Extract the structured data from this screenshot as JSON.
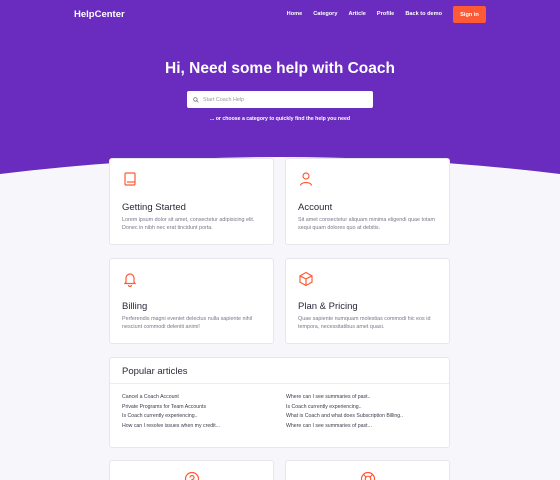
{
  "brand": {
    "name": "HelpCenter",
    "primary": "#6a2bbf",
    "accent": "#ff5a36"
  },
  "nav": {
    "items": [
      "Home",
      "Category",
      "Article",
      "Profile",
      "Back to demo"
    ],
    "signin": "Sign in"
  },
  "hero": {
    "title": "Hi, Need some help with Coach",
    "search_placeholder": "Start Coach Help",
    "subtitle": "... or choose a category to quickly find the help you need"
  },
  "categories": [
    {
      "icon": "book-icon",
      "title": "Getting Started",
      "desc": "Lorem ipsum dolor sit amet, consectetur adipisicing elit. Donec in nibh nec erat tincidunt porta."
    },
    {
      "icon": "user-icon",
      "title": "Account",
      "desc": "Sit amet consectetur aliquam minima eligendi quae totam sequi quam dolores quo at debitis."
    },
    {
      "icon": "bell-icon",
      "title": "Billing",
      "desc": "Perferendis magni eveniet delectus nulla sapiente nihil nesciunt commodi deleniti animi!"
    },
    {
      "icon": "cube-icon",
      "title": "Plan & Pricing",
      "desc": "Quae sapiente numquam molestias commodi hic eos id tempora, necessitatibus amet quasi."
    }
  ],
  "popular": {
    "title": "Popular articles",
    "left": [
      "Cancel a Coach Account",
      "Private Programs for Team Accounts",
      "Is Coach currently experiencing..",
      "How can I resolve issues when my credit..."
    ],
    "right": [
      "Where can I see summaries of past..",
      "Is Coach currently experiencing..",
      "What is Coach and what does Subscription Billing..",
      "Where can I see summaries of past..."
    ]
  }
}
